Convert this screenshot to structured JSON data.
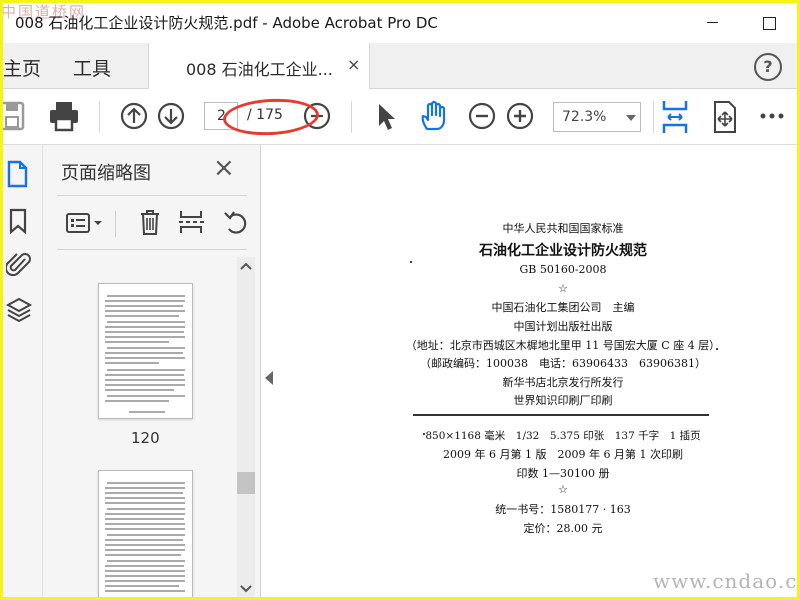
{
  "window": {
    "title": "008 石油化工企业设计防火规范.pdf - Adobe Acrobat Pro DC",
    "watermark_top": "中国道桥网"
  },
  "tabs": {
    "home": "主页",
    "tools": "工具",
    "document": "008 石油化工企业...",
    "close": "×",
    "help": "?"
  },
  "toolbar": {
    "current_page": "2",
    "page_total": "/ 175",
    "zoom": "72.3%"
  },
  "thumbnails_panel": {
    "title": "页面缩略图",
    "close": "×",
    "page_label": "120"
  },
  "document": {
    "lines": [
      "中华人民共和国国家标准",
      "石油化工企业设计防火规范",
      "GB 50160-2008",
      "☆",
      "中国石油化工集团公司　主编",
      "中国计划出版社出版",
      "（地址：北京市西城区木樨地北里甲 11 号国宏大厦 C 座 4 层）",
      "（邮政编码：100038　电话：63906433　63906381）",
      "新华书店北京发行所发行",
      "世界知识印刷厂印刷",
      "850×1168 毫米　1/32　5.375 印张　137 千字　1 插页",
      "2009 年 6 月第 1 版　2009 年 6 月第 1 次印刷",
      "印数 1—30100 册",
      "☆",
      "统一书号：1580177 · 163",
      "定价：28.00 元"
    ],
    "watermark_bottom": "www.cndao.com"
  },
  "colors": {
    "border": "#f4f419",
    "accent_blue": "#1473e6",
    "annotation_red": "#e63b2e"
  }
}
